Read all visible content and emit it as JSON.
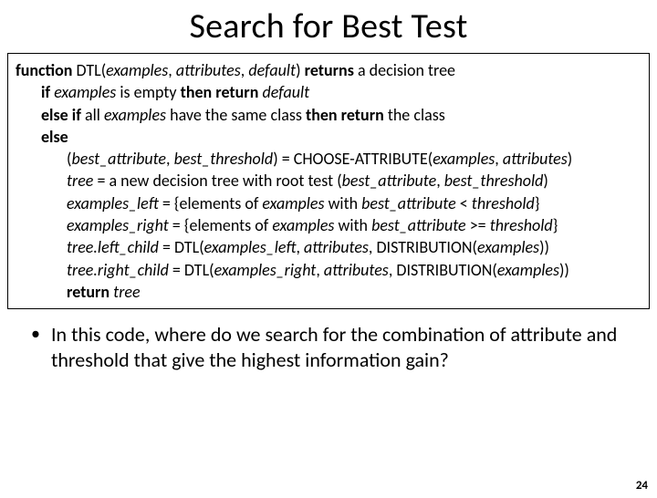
{
  "title": "Search for Best Test",
  "code": {
    "l0": {
      "p0": "function",
      "p1": " DTL(",
      "p2": "examples",
      "p3": ", ",
      "p4": "attributes",
      "p5": ", ",
      "p6": "default",
      "p7": ") ",
      "p8": "returns",
      "p9": " a decision tree"
    },
    "l1": {
      "p0": "if",
      "p1": " ",
      "p2": "examples",
      "p3": " is empty ",
      "p4": "then return",
      "p5": " ",
      "p6": "default"
    },
    "l2": {
      "p0": "else if",
      "p1": " all ",
      "p2": "examples",
      "p3": " have the same class ",
      "p4": "then return",
      "p5": " the class"
    },
    "l3": {
      "p0": "else"
    },
    "l4": {
      "p0": "(",
      "p1": "best_attribute",
      "p2": ", ",
      "p3": "best_threshold",
      "p4": ") = CHOOSE-ATTRIBUTE(",
      "p5": "examples",
      "p6": ", ",
      "p7": "attributes",
      "p8": ")"
    },
    "l5": {
      "p0": "tree",
      "p1": " = a new decision tree with root test (",
      "p2": "best_attribute",
      "p3": ", ",
      "p4": "best_threshold",
      "p5": ")"
    },
    "l6": {
      "p0": "examples_left",
      "p1": " = {elements of ",
      "p2": "examples",
      "p3": " with ",
      "p4": "best_attribute",
      "p5": " < ",
      "p6": "threshold",
      "p7": "}"
    },
    "l7": {
      "p0": "examples_right",
      "p1": " = {elements of ",
      "p2": "examples",
      "p3": " with ",
      "p4": "best_attribute",
      "p5": " >= ",
      "p6": "threshold",
      "p7": "}"
    },
    "l8": {
      "p0": "tree.left_child",
      "p1": " = DTL(",
      "p2": "examples_left",
      "p3": ", ",
      "p4": "attributes",
      "p5": ", DISTRIBUTION(",
      "p6": "examples",
      "p7": "))"
    },
    "l9": {
      "p0": "tree.right_child",
      "p1": " = DTL(",
      "p2": "examples_right",
      "p3": ", ",
      "p4": "attributes",
      "p5": ", DISTRIBUTION(",
      "p6": "examples",
      "p7": "))"
    },
    "l10": {
      "p0": "return",
      "p1": " ",
      "p2": "tree"
    }
  },
  "bullet": "In this code, where do we search for the combination of attribute and threshold that give the  highest information gain?",
  "pagenum": "24"
}
